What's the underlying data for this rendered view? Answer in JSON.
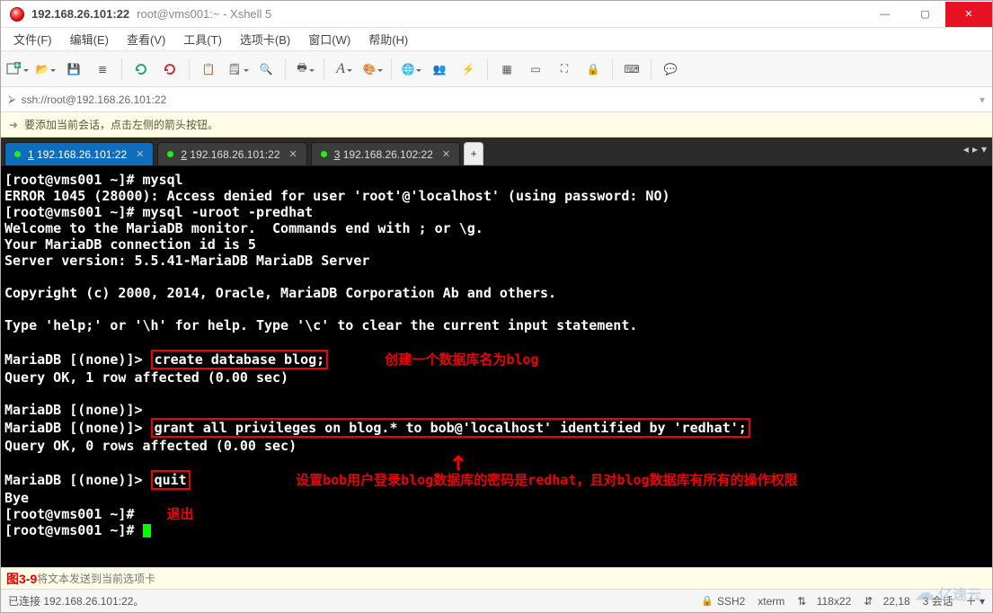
{
  "title": {
    "host": "192.168.26.101:22",
    "session": "root@vms001:~ - Xshell 5"
  },
  "win": {
    "min": "—",
    "max": "▢",
    "close": "✕"
  },
  "menu": {
    "file": "文件(F)",
    "edit": "编辑(E)",
    "view": "查看(V)",
    "tools": "工具(T)",
    "tabs": "选项卡(B)",
    "window": "窗口(W)",
    "help": "帮助(H)"
  },
  "address": {
    "arrow": "⮚",
    "url": "ssh://root@192.168.26.101:22"
  },
  "hintbar": {
    "text": "要添加当前会话，点击左侧的箭头按钮。"
  },
  "tabs": [
    {
      "num": "1",
      "label": "192.168.26.101:22",
      "active": true
    },
    {
      "num": "2",
      "label": "192.168.26.101:22",
      "active": false
    },
    {
      "num": "3",
      "label": "192.168.26.102:22",
      "active": false
    }
  ],
  "add_tab": "+",
  "terminal": {
    "l1": "[root@vms001 ~]# mysql",
    "l2": "ERROR 1045 (28000): Access denied for user 'root'@'localhost' (using password: NO)",
    "l3": "[root@vms001 ~]# mysql -uroot -predhat",
    "l4": "Welcome to the MariaDB monitor.  Commands end with ; or \\g.",
    "l5": "Your MariaDB connection id is 5",
    "l6": "Server version: 5.5.41-MariaDB MariaDB Server",
    "l7": "",
    "l8": "Copyright (c) 2000, 2014, Oracle, MariaDB Corporation Ab and others.",
    "l9": "",
    "l10": "Type 'help;' or '\\h' for help. Type '\\c' to clear the current input statement.",
    "l11": "",
    "p_a": "MariaDB [(none)]> ",
    "boxed_a": "create database blog;",
    "note_a": "创建一个数据库名为blog",
    "l13": "Query OK, 1 row affected (0.00 sec)",
    "l14": "",
    "l15": "MariaDB [(none)]>",
    "p_b": "MariaDB [(none)]> ",
    "boxed_b": "grant all privileges on blog.* to bob@'localhost' identified by 'redhat';",
    "l17": "Query OK, 0 rows affected (0.00 sec)",
    "l18": "",
    "p_c": "MariaDB [(none)]> ",
    "boxed_c": "quit",
    "note_c": "设置bob用户登录blog数据库的密码是redhat，且对blog数据库有所有的操作权限",
    "l20": "Bye",
    "l21": "[root@vms001 ~]# ",
    "note_quit": "退出",
    "l22": "[root@vms001 ~]# "
  },
  "footer_hint": "将文本发送到当前选项卡",
  "fig_label": "图3-9",
  "status": {
    "conn": "已连接 192.168.26.101:22。",
    "proto": "SSH2",
    "termtype": "xterm",
    "size": "118x22",
    "cursorpos": "22,18",
    "sessions_label": "3 会话",
    "updown1": "⇅",
    "updown2": "⇵"
  },
  "watermark": "亿速云",
  "icons": {
    "newtab": "＋",
    "open": "📂",
    "save": "💾",
    "props": "≣",
    "copy": "📋",
    "paste": "🗒",
    "find": "🔍",
    "printer": "🖶",
    "font": "A",
    "colors": "🎨",
    "globe": "🌐",
    "people": "👥",
    "bolt": "⚡",
    "scale": "▭",
    "focus": "⛶",
    "lock": "🔒",
    "kbd": "⌨",
    "chat": "💬",
    "grid": "▦"
  }
}
